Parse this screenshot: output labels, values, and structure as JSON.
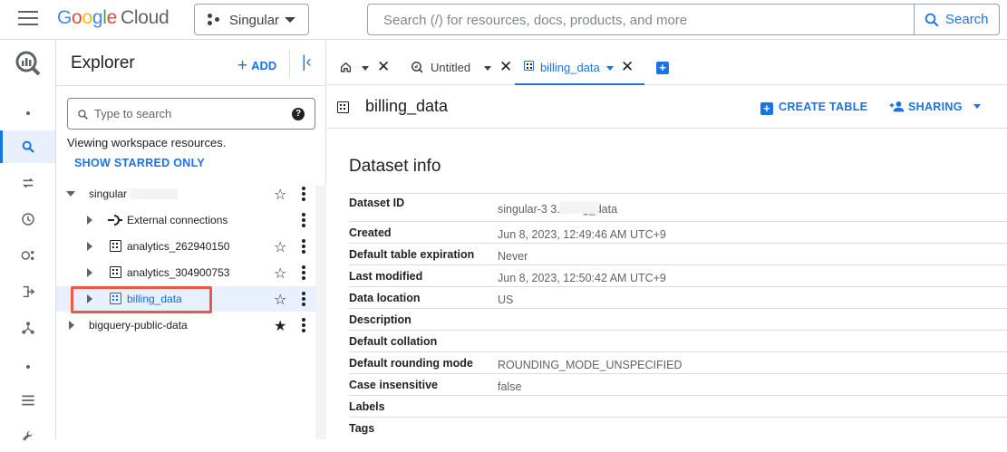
{
  "header": {
    "logo_google": [
      "G",
      "o",
      "o",
      "g",
      "l",
      "e"
    ],
    "logo_cloud": "Cloud",
    "project_name": "Singular",
    "search_placeholder": "Search (/) for resources, docs, products, and more",
    "search_button": "Search"
  },
  "explorer": {
    "title": "Explorer",
    "add_label": "ADD",
    "search_placeholder": "Type to search",
    "viewing_text": "Viewing workspace resources.",
    "show_starred_label": "SHOW STARRED ONLY",
    "tree": [
      {
        "label": "singular",
        "expanded": true,
        "starred": false
      },
      {
        "label": "External connections",
        "type": "connection"
      },
      {
        "label": "analytics_262940150",
        "type": "dataset",
        "starred": false
      },
      {
        "label": "analytics_304900753",
        "type": "dataset",
        "starred": false
      },
      {
        "label": "billing_data",
        "type": "dataset",
        "starred": false,
        "selected": true
      },
      {
        "label": "bigquery-public-data",
        "expanded": false,
        "starred": true
      }
    ]
  },
  "tabs": [
    {
      "label": "",
      "icon": "home-icon"
    },
    {
      "label": "Untitled",
      "icon": "query-icon"
    },
    {
      "label": "billing_data",
      "icon": "dataset-icon",
      "active": true
    }
  ],
  "dataset": {
    "title": "billing_data",
    "create_table_label": "CREATE TABLE",
    "sharing_label": "SHARING",
    "info_title": "Dataset info",
    "info": [
      {
        "key": "Dataset ID",
        "value": "singular-3     3.billing_data"
      },
      {
        "key": "Created",
        "value": "Jun 8, 2023, 12:49:46 AM UTC+9"
      },
      {
        "key": "Default table expiration",
        "value": "Never"
      },
      {
        "key": "Last modified",
        "value": "Jun 8, 2023, 12:50:42 AM UTC+9"
      },
      {
        "key": "Data location",
        "value": "US"
      },
      {
        "key": "Description",
        "value": ""
      },
      {
        "key": "Default collation",
        "value": ""
      },
      {
        "key": "Default rounding mode",
        "value": "ROUNDING_MODE_UNSPECIFIED"
      },
      {
        "key": "Case insensitive",
        "value": "false"
      },
      {
        "key": "Labels",
        "value": ""
      },
      {
        "key": "Tags",
        "value": ""
      }
    ]
  },
  "colors": {
    "accent": "#1a73e8",
    "selected_bg": "#e8f0fe",
    "highlight": "#e8594a"
  }
}
